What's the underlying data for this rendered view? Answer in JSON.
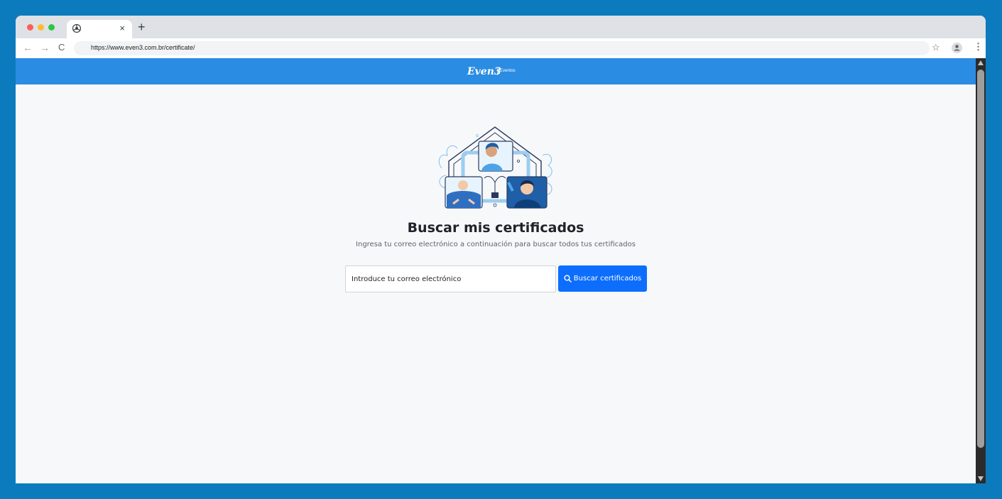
{
  "browser": {
    "tab_close": "×",
    "new_tab": "+",
    "url": "https://www.even3.com.br/certificate/",
    "nav_back": "←",
    "nav_forward": "→",
    "nav_reload": "C",
    "bookmark_star": "☆",
    "menu": "⋮"
  },
  "site": {
    "logo": "Even3",
    "logo_sub": "Eventos",
    "header_color": "#2b8ce3"
  },
  "main": {
    "title": "Buscar mis certificados",
    "subtitle": "Ingresa tu correo electrónico a continuación para buscar todos tus certificados",
    "email_placeholder": "Introduce tu correo electrónico",
    "search_button_label": "Buscar certificados",
    "button_color": "#0d6efd"
  }
}
